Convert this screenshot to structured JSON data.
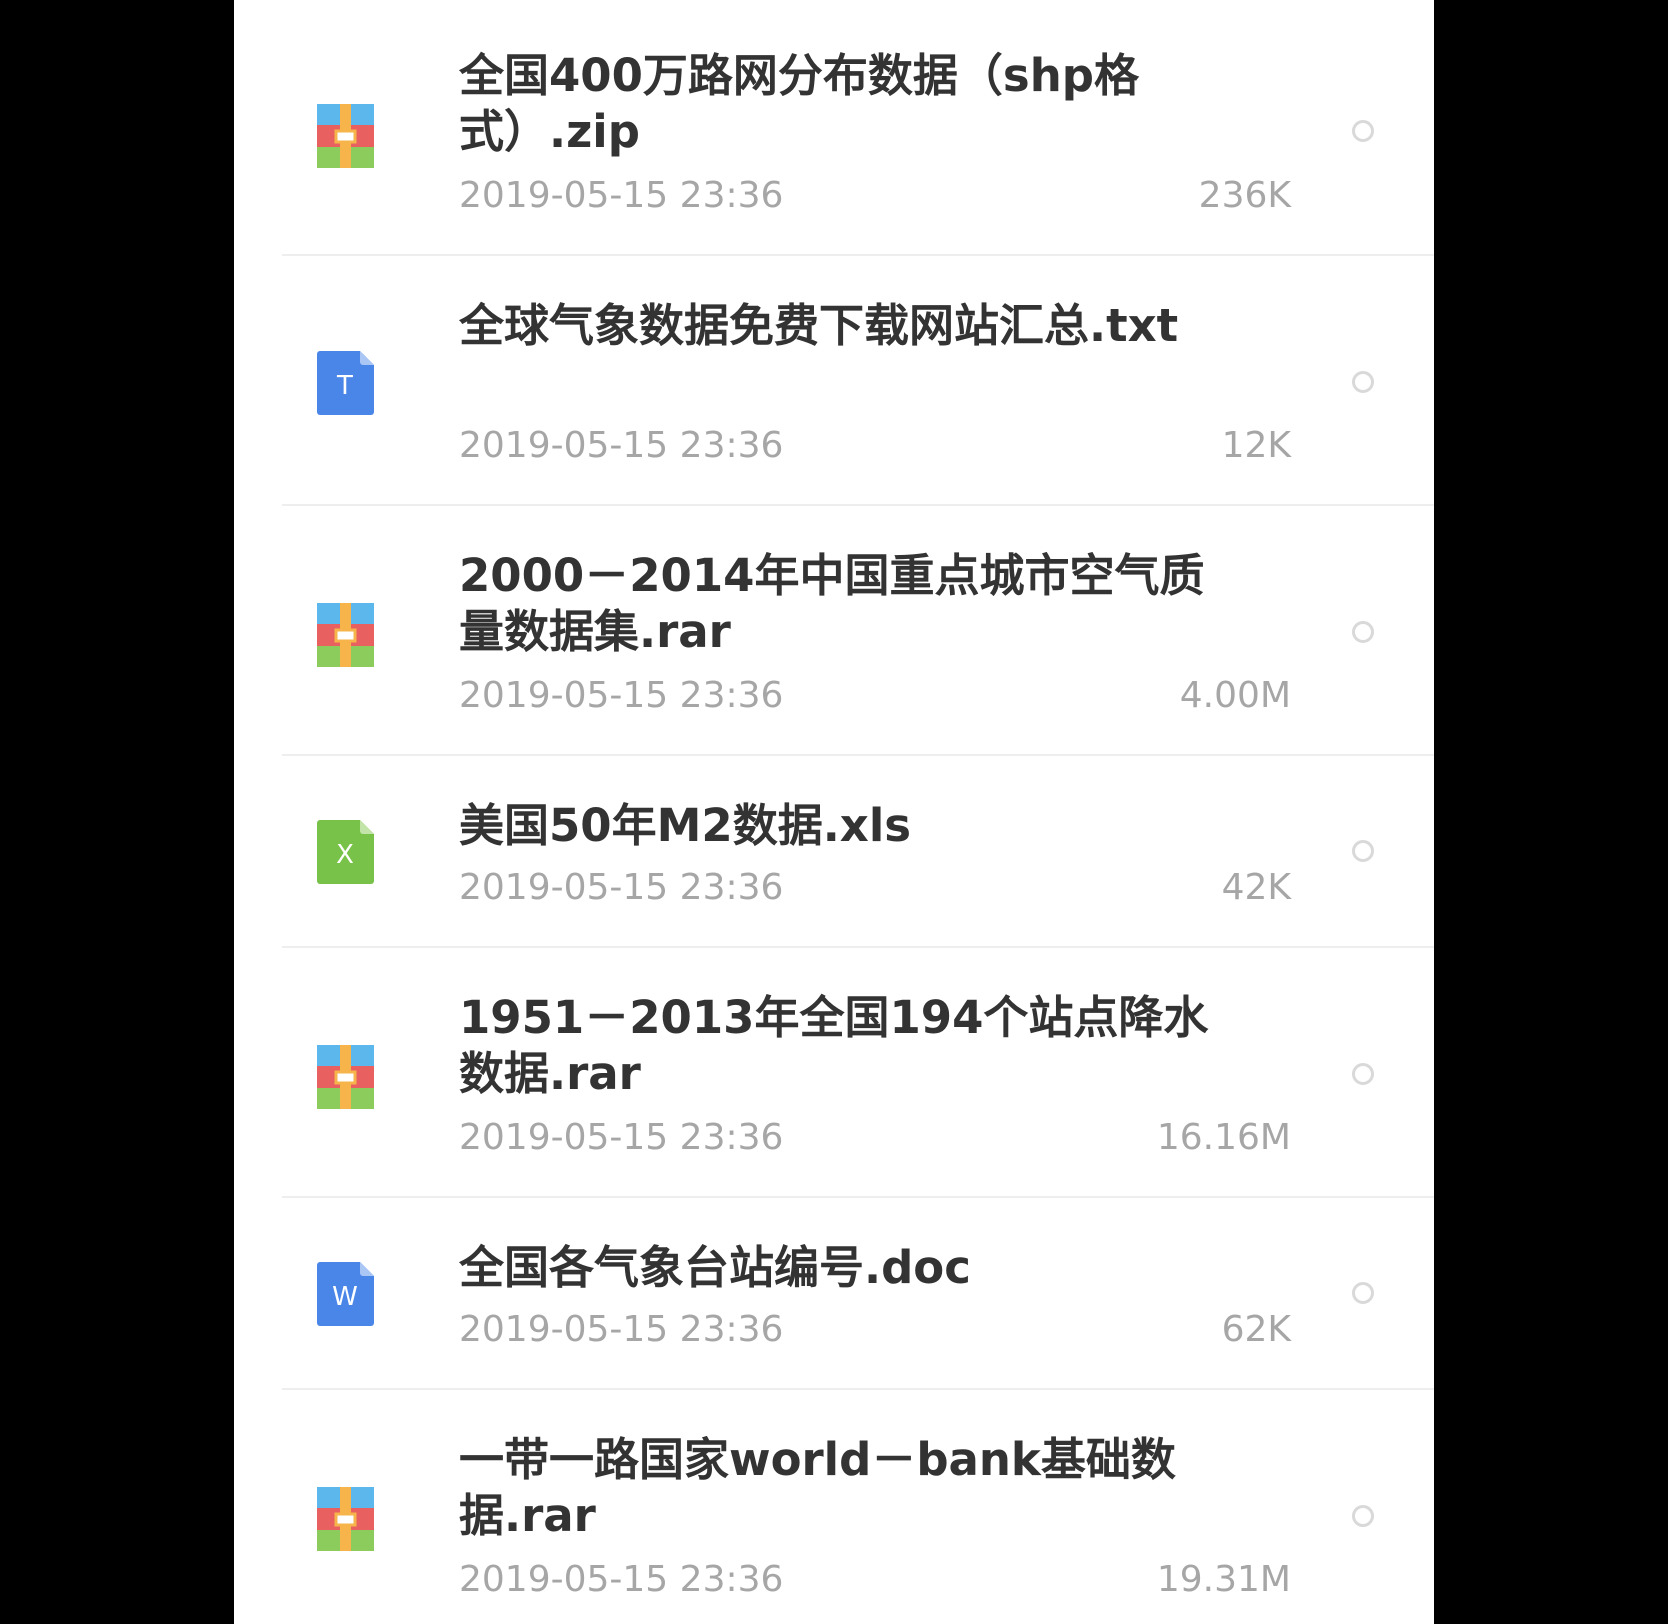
{
  "files": [
    {
      "name": "全国400万路网分布数据（shp格式）.zip",
      "date": "2019-05-15 23:36",
      "size": "236K",
      "type": "archive",
      "icon": "archive-icon"
    },
    {
      "name": "全球气象数据免费下载网站汇总.txt",
      "date": "2019-05-15 23:36",
      "size": "12K",
      "type": "text",
      "icon": "text-file-icon",
      "icon_letter": "T"
    },
    {
      "name": "2000－2014年中国重点城市空气质量数据集.rar",
      "date": "2019-05-15 23:36",
      "size": "4.00M",
      "type": "archive",
      "icon": "archive-icon"
    },
    {
      "name": "美国50年M2数据.xls",
      "date": "2019-05-15 23:36",
      "size": "42K",
      "type": "excel",
      "icon": "excel-file-icon",
      "icon_letter": "X"
    },
    {
      "name": "1951－2013年全国194个站点降水数据.rar",
      "date": "2019-05-15 23:36",
      "size": "16.16M",
      "type": "archive",
      "icon": "archive-icon"
    },
    {
      "name": "全国各气象台站编号.doc",
      "date": "2019-05-15 23:36",
      "size": "62K",
      "type": "word",
      "icon": "word-file-icon",
      "icon_letter": "W"
    },
    {
      "name": "一带一路国家world－bank基础数据.rar",
      "date": "2019-05-15 23:36",
      "size": "19.31M",
      "type": "archive",
      "icon": "archive-icon"
    }
  ],
  "colors": {
    "archive_blue": "#5cb8ec",
    "archive_red": "#e8605f",
    "archive_green": "#8ccc5c",
    "archive_band": "#f6b44a",
    "text_blue": "#4a86e8",
    "excel_green": "#79c24a",
    "word_blue": "#4a86e8",
    "title_text": "#333333",
    "meta_text": "#a6a6a6"
  }
}
